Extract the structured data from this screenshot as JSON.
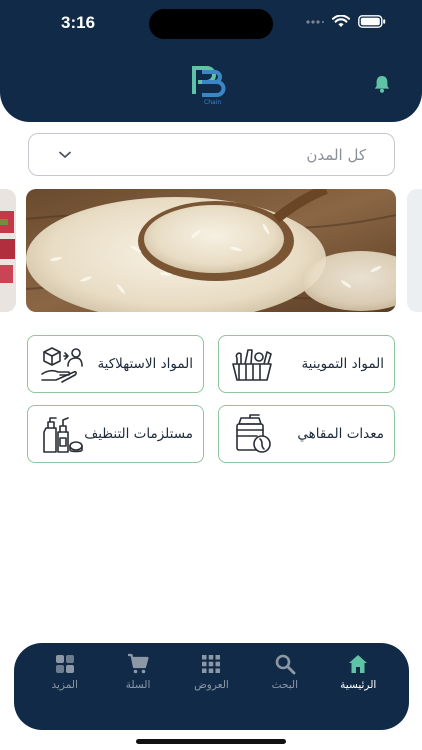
{
  "status_bar": {
    "time": "3:16"
  },
  "header": {
    "logo_caption": "Chain",
    "bell_icon": "bell-icon"
  },
  "city_select": {
    "value": "كل المدن",
    "chevron_icon": "chevron-down-icon"
  },
  "banner": {
    "image": "rice-on-wooden-spoon"
  },
  "categories": [
    {
      "label": "المواد التموينية",
      "icon": "grocery-basket-icon"
    },
    {
      "label": "المواد الاستهلاكية",
      "icon": "consumables-hand-box-icon"
    },
    {
      "label": "معدات المقاهي",
      "icon": "coffee-grinder-icon"
    },
    {
      "label": "مستلزمات التنظيف",
      "icon": "cleaning-supplies-icon"
    }
  ],
  "tabbar": {
    "items": [
      {
        "label": "الرئيسية",
        "icon": "home-icon",
        "active": true
      },
      {
        "label": "البحث",
        "icon": "search-icon",
        "active": false
      },
      {
        "label": "العروض",
        "icon": "grid-icon",
        "active": false
      },
      {
        "label": "السلة",
        "icon": "cart-icon",
        "active": false
      },
      {
        "label": "المزيد",
        "icon": "more-icon",
        "active": false
      }
    ]
  },
  "colors": {
    "primary": "#102a48",
    "accent": "#5fc4a6",
    "card_border": "#8fc49e"
  }
}
